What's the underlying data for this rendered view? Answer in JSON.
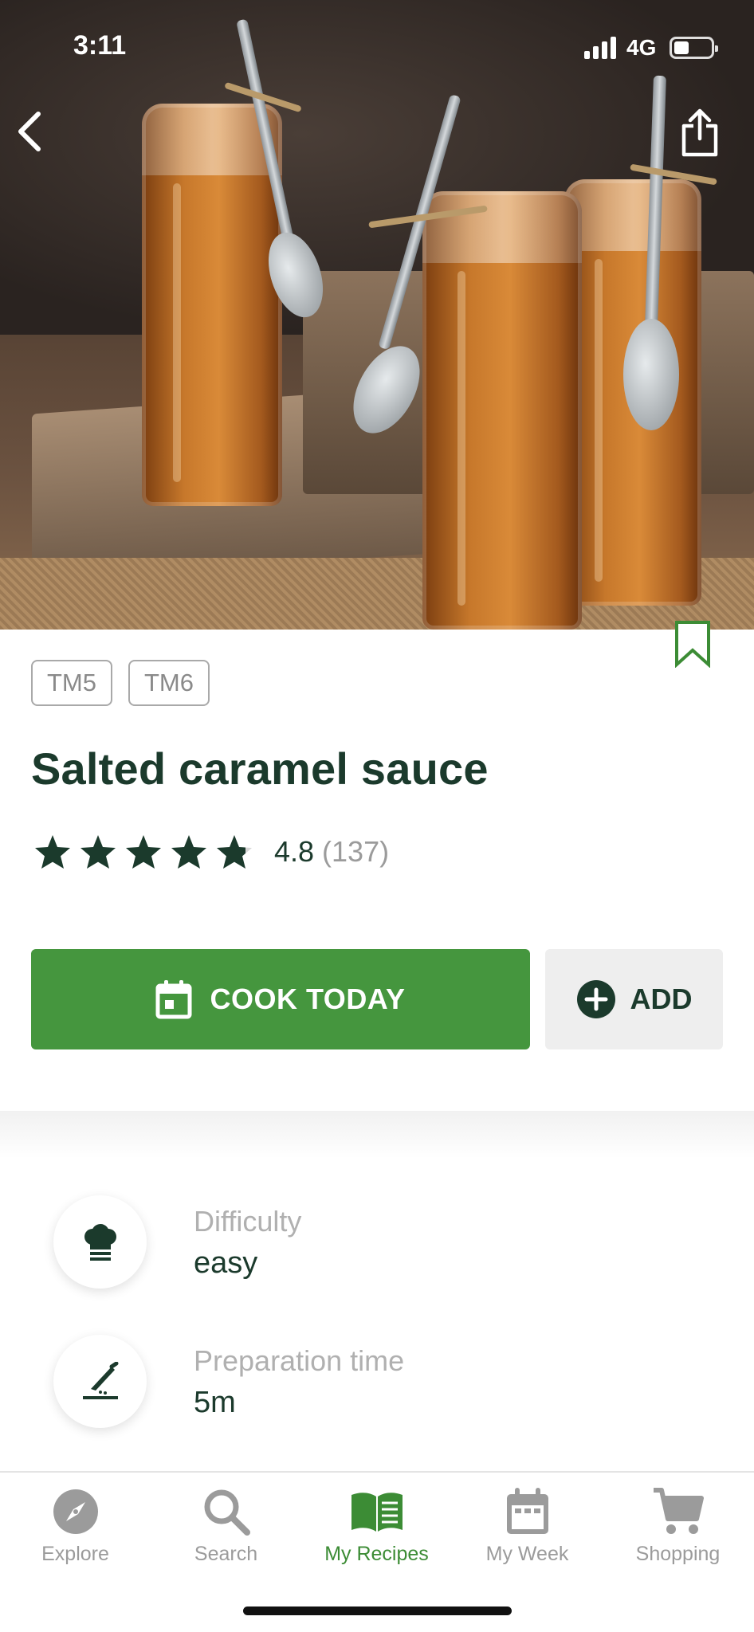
{
  "status_bar": {
    "time": "3:11",
    "network": "4G"
  },
  "hero": {
    "image": "caramel-sauce-jars-photo"
  },
  "recipe": {
    "devices": [
      "TM5",
      "TM6"
    ],
    "title": "Salted caramel sauce",
    "rating": {
      "stars": 4.8,
      "score": "4.8",
      "count": "(137)"
    }
  },
  "actions": {
    "cook_today": "COOK TODAY",
    "add": "ADD"
  },
  "details": [
    {
      "icon": "chef-hat-icon",
      "label": "Difficulty",
      "value": "easy"
    },
    {
      "icon": "knife-board-icon",
      "label": "Preparation time",
      "value": "5m"
    }
  ],
  "tabs": [
    {
      "label": "Explore",
      "icon": "compass-icon",
      "active": false
    },
    {
      "label": "Search",
      "icon": "search-icon",
      "active": false
    },
    {
      "label": "My Recipes",
      "icon": "open-book-icon",
      "active": true
    },
    {
      "label": "My Week",
      "icon": "calendar-icon",
      "active": false
    },
    {
      "label": "Shopping",
      "icon": "cart-icon",
      "active": false
    }
  ],
  "colors": {
    "primary_green": "#45963e",
    "title_dark": "#1b3a2c",
    "muted_gray": "#9b9b9b"
  }
}
